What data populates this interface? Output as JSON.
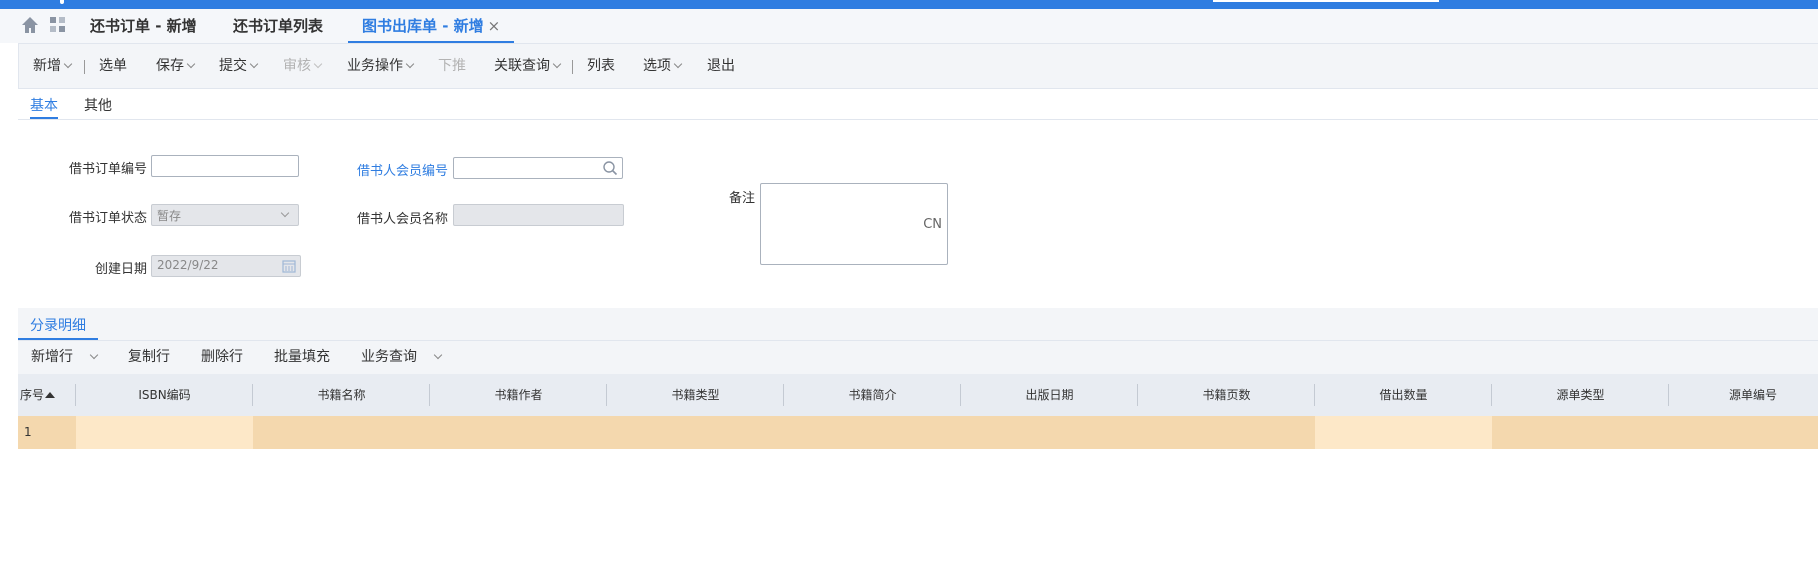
{
  "tabs": [
    {
      "label": "还书订单 - 新增"
    },
    {
      "label": "还书订单列表"
    },
    {
      "label": "图书出库单 - 新增",
      "close": "×"
    }
  ],
  "toolbar": {
    "items": [
      "新增",
      "选单",
      "保存",
      "提交",
      "审核",
      "业务操作",
      "下推",
      "关联查询",
      "列表",
      "选项",
      "退出"
    ]
  },
  "subtabs": [
    "基本",
    "其他"
  ],
  "form": {
    "order_no_label": "借书订单编号",
    "order_no_value": "",
    "status_label": "借书订单状态",
    "status_value": "暂存",
    "date_label": "创建日期",
    "date_value": "2022/9/22",
    "member_no_label": "借书人会员编号",
    "member_no_value": "",
    "member_name_label": "借书人会员名称",
    "member_name_value": "",
    "remark_label": "备注",
    "remark_lang": "CN"
  },
  "detail": {
    "tab": "分录明细",
    "tools": [
      "新增行",
      "复制行",
      "删除行",
      "批量填充",
      "业务查询"
    ]
  },
  "grid": {
    "columns": [
      "序号",
      "ISBN编码",
      "书籍名称",
      "书籍作者",
      "书籍类型",
      "书籍简介",
      "出版日期",
      "书籍页数",
      "借出数量",
      "源单类型",
      "源单编号"
    ],
    "rows": [
      [
        "1",
        "",
        "",
        "",
        "",
        "",
        "",
        "",
        "",
        "",
        ""
      ]
    ]
  },
  "colors": {
    "brand_blue": "#2f7de1",
    "row_highlight": "#f4d8ae",
    "editable_cell": "#fde8c8"
  }
}
